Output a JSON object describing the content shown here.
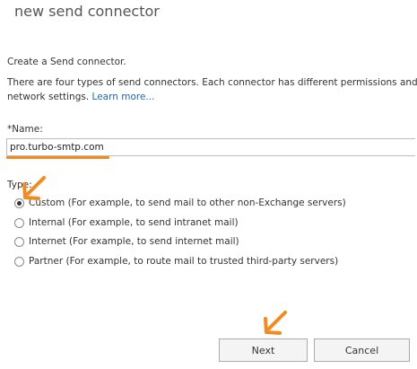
{
  "dialog": {
    "title": "new send connector",
    "intro": "Create a Send connector.",
    "description": "There are four types of send connectors. Each connector has different permissions and network settings.",
    "learn_more": "Learn more..."
  },
  "name_field": {
    "label": "*Name:",
    "value": "pro.turbo-smtp.com"
  },
  "type_group": {
    "label": "Type:",
    "options": [
      {
        "label": "Custom (For example, to send mail to other non-Exchange servers)",
        "selected": true
      },
      {
        "label": "Internal (For example, to send intranet mail)",
        "selected": false
      },
      {
        "label": "Internet (For example, to send internet mail)",
        "selected": false
      },
      {
        "label": "Partner (For example, to route mail to trusted third-party servers)",
        "selected": false
      }
    ]
  },
  "buttons": {
    "next": "Next",
    "cancel": "Cancel"
  },
  "annotation_color": "#f28b1e"
}
